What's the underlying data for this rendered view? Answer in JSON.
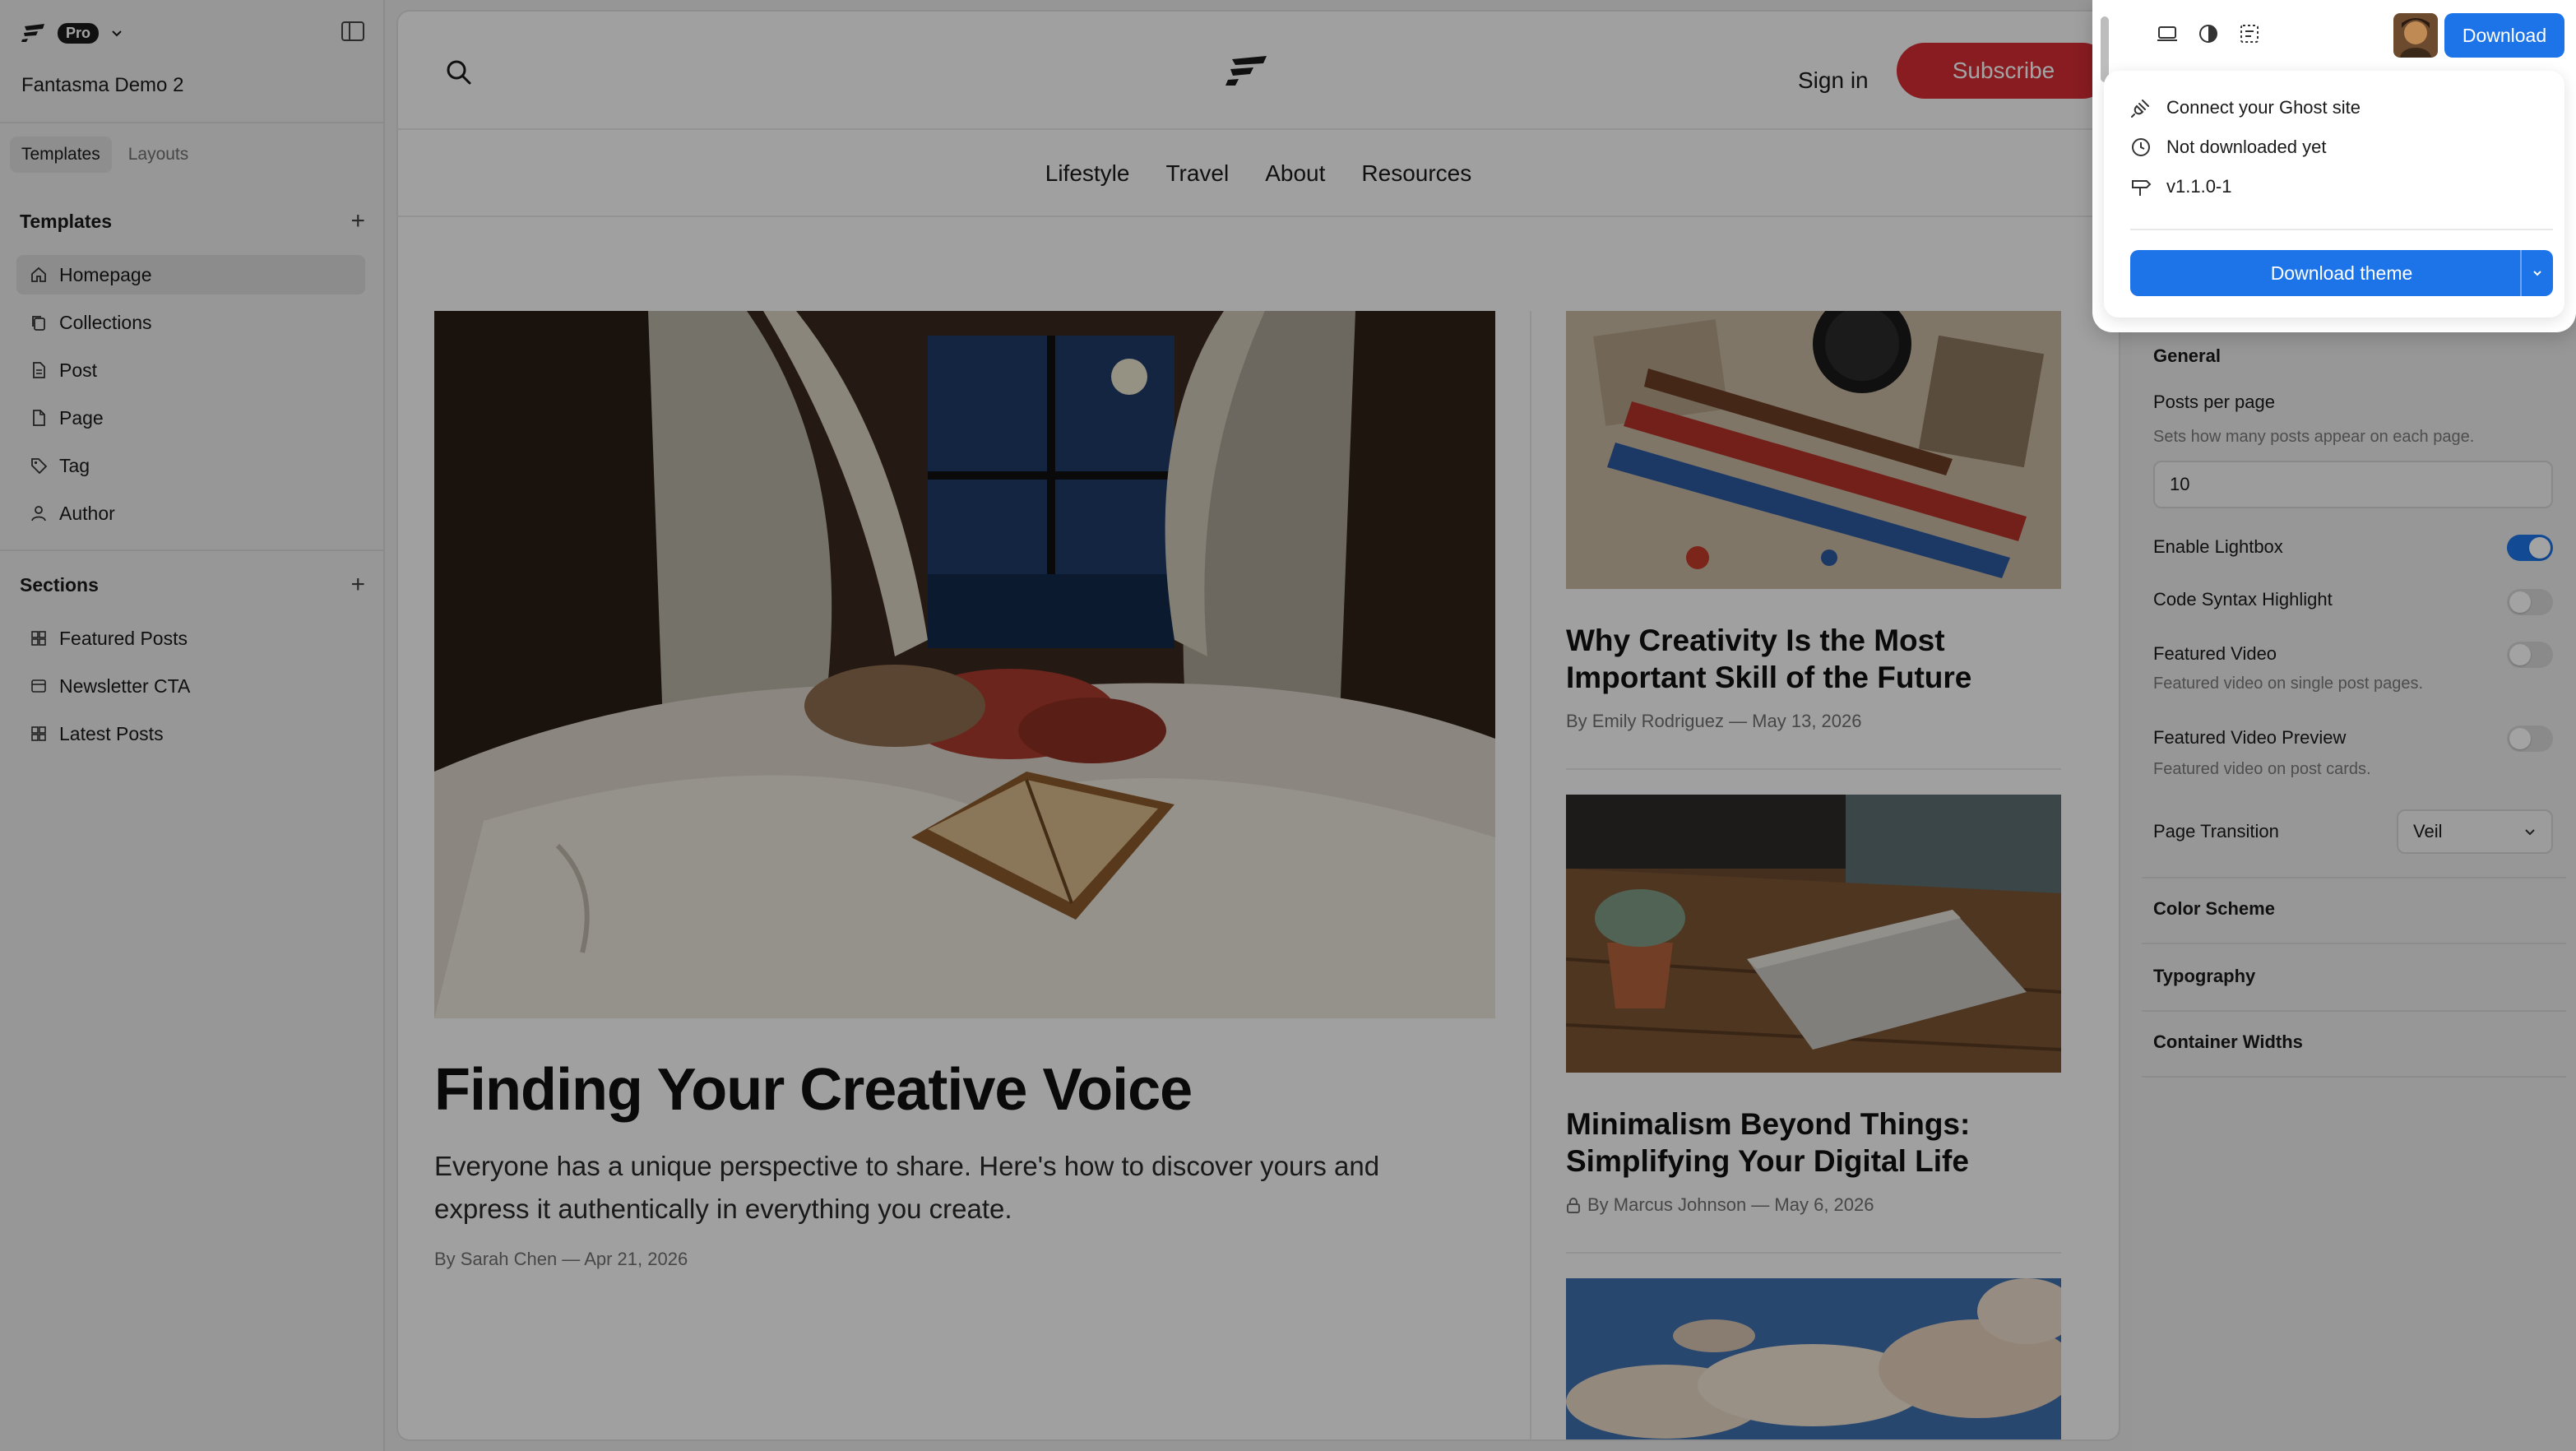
{
  "sidebar": {
    "plan_badge": "Pro",
    "site_name": "Fantasma Demo 2",
    "tabs": [
      {
        "label": "Templates",
        "active": true
      },
      {
        "label": "Layouts",
        "active": false
      }
    ],
    "templates_heading": "Templates",
    "templates": [
      {
        "label": "Homepage",
        "icon": "home-icon",
        "active": true
      },
      {
        "label": "Collections",
        "icon": "copy-icon"
      },
      {
        "label": "Post",
        "icon": "document-icon"
      },
      {
        "label": "Page",
        "icon": "file-icon"
      },
      {
        "label": "Tag",
        "icon": "tag-icon"
      },
      {
        "label": "Author",
        "icon": "user-icon"
      }
    ],
    "sections_heading": "Sections",
    "sections": [
      {
        "label": "Featured Posts",
        "icon": "grid-icon"
      },
      {
        "label": "Newsletter CTA",
        "icon": "window-icon"
      },
      {
        "label": "Latest Posts",
        "icon": "grid-icon"
      }
    ]
  },
  "preview": {
    "signin": "Sign in",
    "subscribe": "Subscribe",
    "nav": [
      "Lifestyle",
      "Travel",
      "About",
      "Resources"
    ],
    "featured": {
      "title": "Finding Your Creative Voice",
      "excerpt": "Everyone has a unique perspective to share. Here's how to discover yours and express it authentically in everything you create.",
      "byline": "By Sarah Chen — Apr 21, 2026"
    },
    "cards": [
      {
        "title": "Why Creativity Is the Most Important Skill of the Future",
        "byline": "By Emily Rodriguez — May 13, 2026",
        "locked": false
      },
      {
        "title": "Minimalism Beyond Things: Simplifying Your Digital Life",
        "byline": "By Marcus Johnson — May 6, 2026",
        "locked": true
      }
    ]
  },
  "toolbar": {
    "download_label": "Download"
  },
  "popover": {
    "connect": "Connect your Ghost site",
    "status": "Not downloaded yet",
    "version": "v1.1.0-1",
    "download_theme": "Download theme"
  },
  "settings": {
    "general_heading": "General",
    "posts_per_page_label": "Posts per page",
    "posts_per_page_help": "Sets how many posts appear on each page.",
    "posts_per_page_value": "10",
    "toggles": [
      {
        "label": "Enable Lightbox",
        "on": true
      },
      {
        "label": "Code Syntax Highlight",
        "on": false
      },
      {
        "label": "Featured Video",
        "help": "Featured video on single post pages.",
        "on": false
      },
      {
        "label": "Featured Video Preview",
        "help": "Featured video on post cards.",
        "on": false
      }
    ],
    "page_transition_label": "Page Transition",
    "page_transition_value": "Veil",
    "collapsed_sections": [
      "Color Scheme",
      "Typography",
      "Container Widths"
    ]
  },
  "colors": {
    "accent_blue": "#1d74e8",
    "subscribe_red": "#d52c35"
  }
}
